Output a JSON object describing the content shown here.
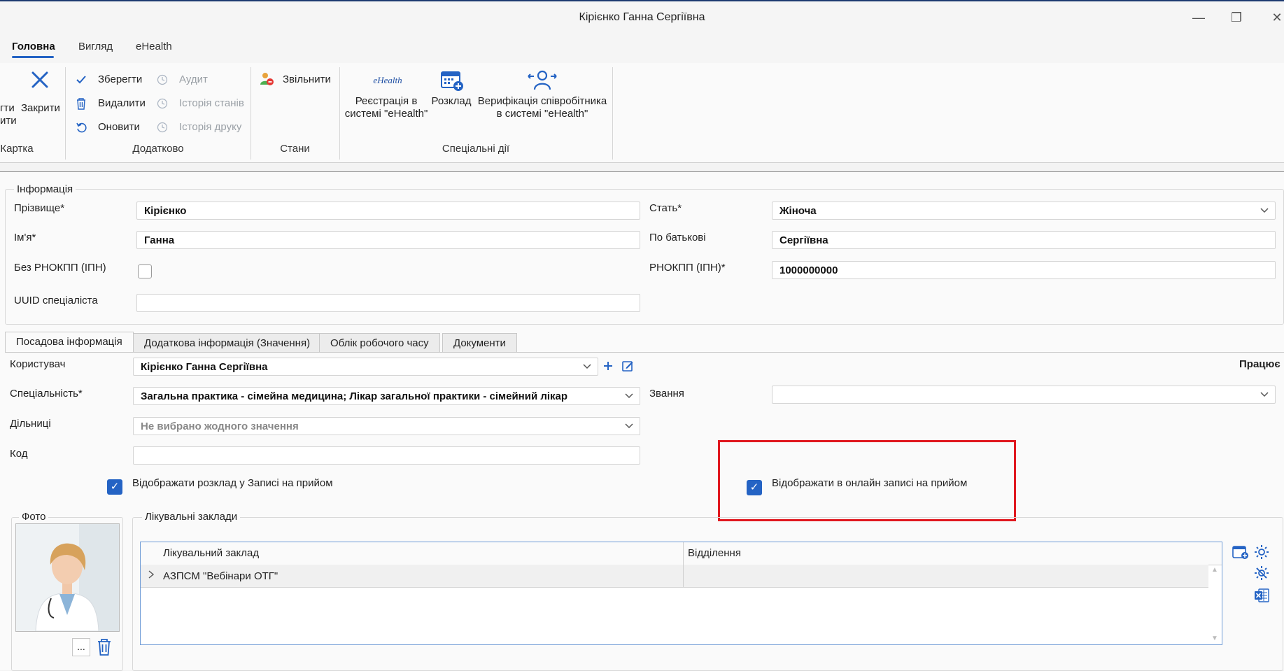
{
  "window": {
    "title": "Кірієнко Ганна Сергіївна",
    "minimize": "—",
    "restore": "❐",
    "close": "✕"
  },
  "menu": {
    "tabs": [
      "Головна",
      "Вигляд",
      "eHealth"
    ]
  },
  "ribbon": {
    "card": {
      "partial_label_1": "гти",
      "partial_label_2": "ити",
      "close_label": "Закрити",
      "group_label": "Картка"
    },
    "additional": {
      "save": "Зберегти",
      "delete": "Видалити",
      "refresh": "Оновити",
      "audit": "Аудит",
      "state_history": "Історія станів",
      "print_history": "Історія друку",
      "group_label": "Додатково"
    },
    "states": {
      "dismiss": "Звільнити",
      "group_label": "Стани"
    },
    "special": {
      "register_line1": "Реєстрація в",
      "register_line2": "системі \"eHealth\"",
      "ehealth_logo": "eHealth",
      "schedule": "Розклад",
      "verify_line1": "Верифікація співробітника",
      "verify_line2": "в системі \"eHealth\"",
      "group_label": "Спеціальні дії"
    }
  },
  "info": {
    "legend": "Інформація",
    "surname_label": "Прізвище*",
    "surname": "Кірієнко",
    "name_label": "Ім'я*",
    "name": "Ганна",
    "no_rnokpp_label": "Без РНОКПП (ІПН)",
    "uuid_label": "UUID спеціаліста",
    "uuid": "",
    "gender_label": "Стать*",
    "gender": "Жіноча",
    "patronymic_label": "По батькові",
    "patronymic": "Сергіївна",
    "rnokpp_label": "РНОКПП (ІПН)*",
    "rnokpp": "1000000000"
  },
  "tabs": [
    "Посадова інформація",
    "Додаткова інформація (Значення)",
    "Облік робочого часу",
    "Документи"
  ],
  "position": {
    "user_label": "Користувач",
    "user": "Кірієнко Ганна Сергіївна",
    "status_partial": "Працює",
    "specialty_label": "Спеціальність*",
    "specialty": "Загальна практика - сімейна медицина; Лікар загальної практики - сімейний лікар",
    "rank_label": "Звання",
    "rank": "",
    "districts_label": "Дільниці",
    "districts_placeholder": "Не вибрано жодного значення",
    "code_label": "Код",
    "code": "",
    "show_schedule_label": "Відображати розклад у Записі на прийом",
    "show_online_label": "Відображати в онлайн записі на прийом"
  },
  "photo": {
    "legend": "Фото",
    "browse_button": "..."
  },
  "facilities": {
    "legend": "Лікувальні заклади",
    "columns": [
      "Лікувальний заклад",
      "Відділення"
    ],
    "rows": [
      {
        "facility": "АЗПСМ \"Вебінари ОТГ\"",
        "department": ""
      }
    ]
  },
  "colors": {
    "accent": "#2463c4",
    "highlight": "#e0181f"
  }
}
